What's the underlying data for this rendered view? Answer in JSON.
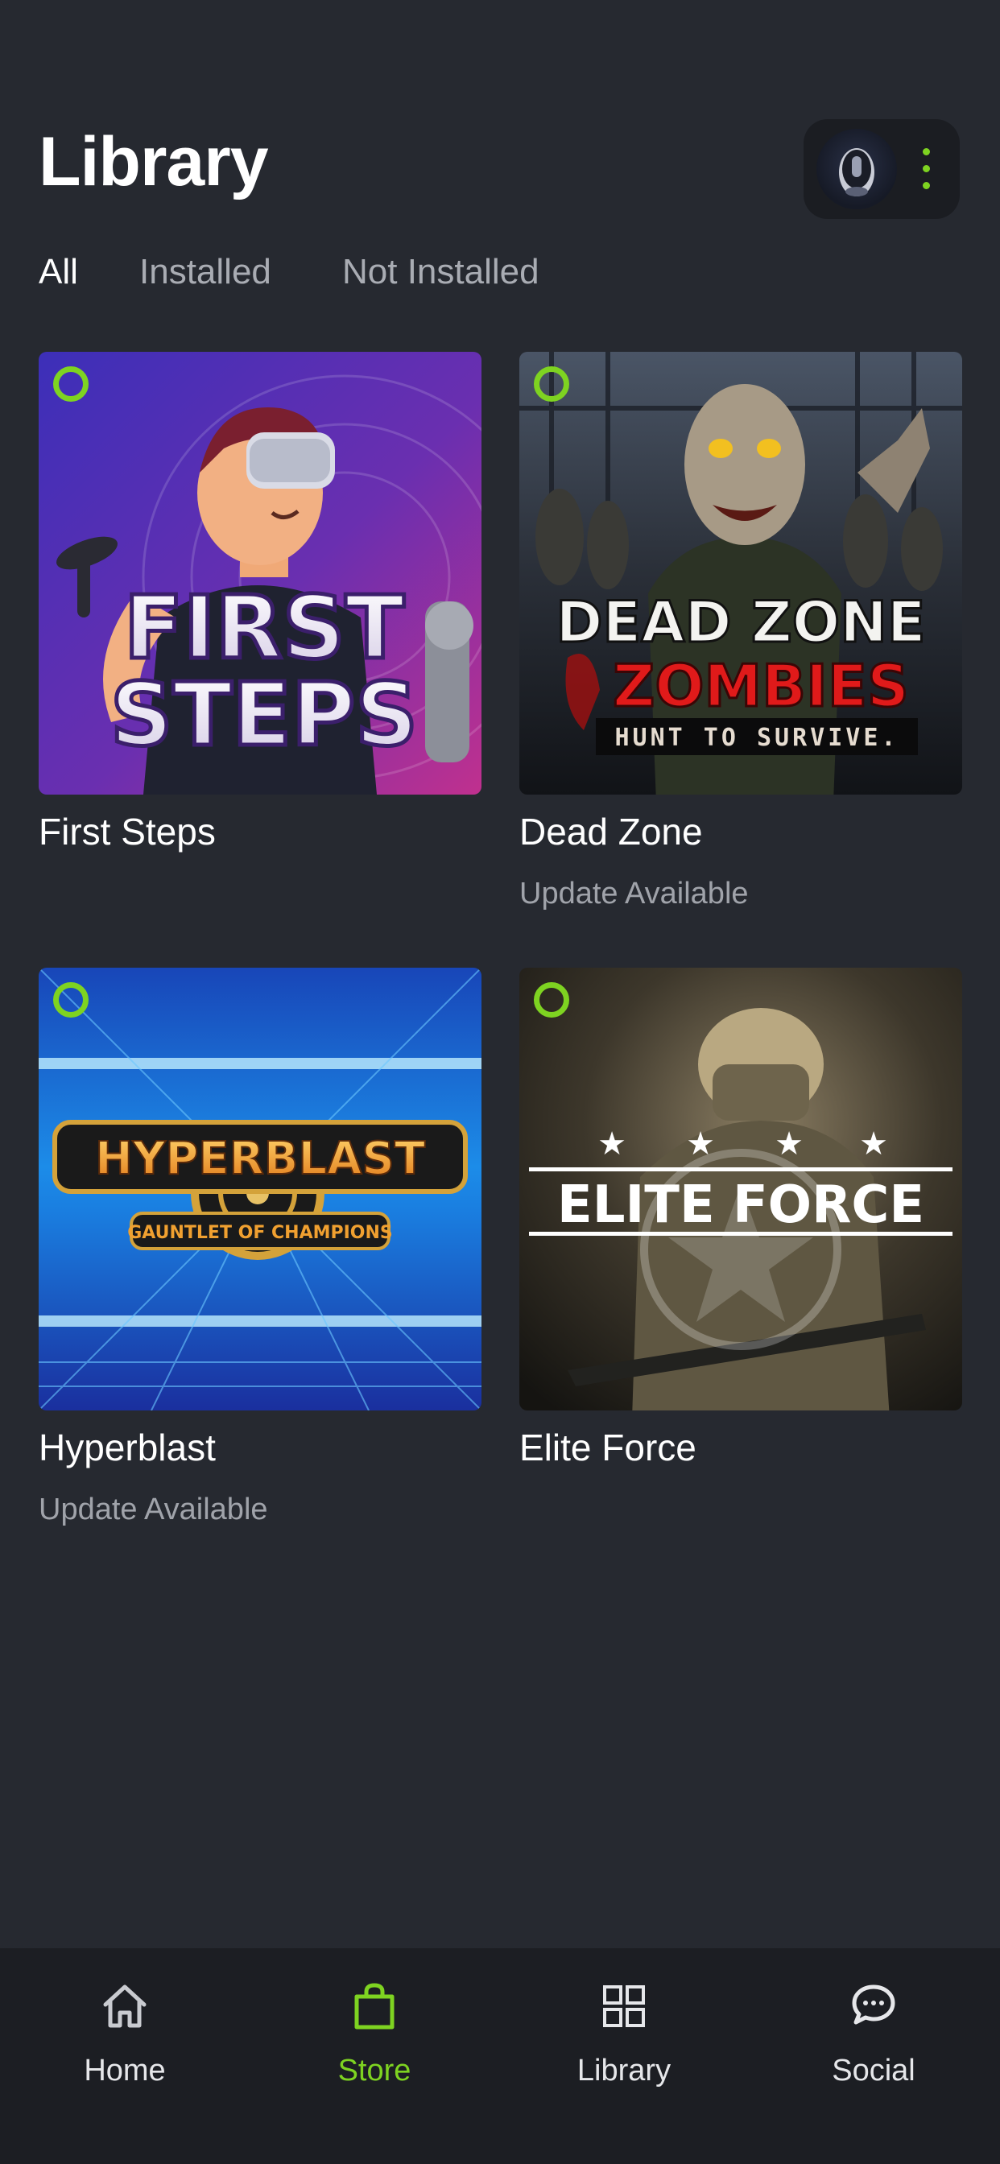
{
  "header": {
    "title": "Library",
    "device_avatar_icon": "vr-headset-avatar-icon",
    "more_icon": "vertical-dots-icon"
  },
  "filters": {
    "tabs": [
      {
        "label": "All",
        "active": true
      },
      {
        "label": "Installed",
        "active": false
      },
      {
        "label": "Not Installed",
        "active": false
      }
    ]
  },
  "games": [
    {
      "title": "First Steps",
      "status": "",
      "cover_text": [
        "FIRST",
        "STEPS"
      ]
    },
    {
      "title": "Dead Zone",
      "status": "Update Available",
      "cover_text": [
        "DEAD ZONE",
        "ZOMBIES",
        "HUNT TO SURVIVE."
      ]
    },
    {
      "title": "Hyperblast",
      "status": "Update Available",
      "cover_text": [
        "HYPERBLAST",
        "GAUNTLET OF CHAMPIONS"
      ]
    },
    {
      "title": "Elite Force",
      "status": "",
      "cover_text": [
        "ELITE FORCE"
      ]
    }
  ],
  "bottom_nav": {
    "items": [
      {
        "label": "Home",
        "icon": "home-icon",
        "active": false
      },
      {
        "label": "Store",
        "icon": "shopping-bag-icon",
        "active": true
      },
      {
        "label": "Library",
        "icon": "grid-icon",
        "active": false
      },
      {
        "label": "Social",
        "icon": "chat-bubbles-icon",
        "active": false
      }
    ]
  },
  "colors": {
    "background": "#262930",
    "nav_background": "#1c1e23",
    "accent": "#7ed321",
    "secondary_text": "#a0a3aa"
  }
}
